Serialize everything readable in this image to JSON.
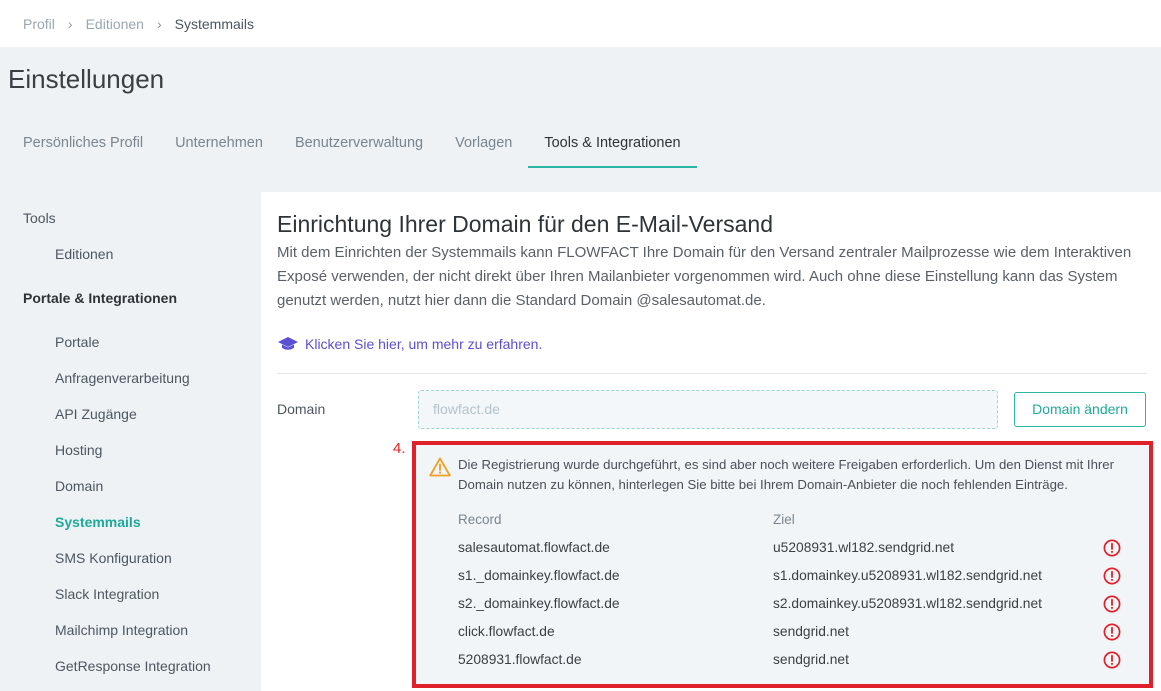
{
  "breadcrumb": {
    "items": [
      "Profil",
      "Editionen",
      "Systemmails"
    ]
  },
  "page_title": "Einstellungen",
  "tabs": [
    {
      "label": "Persönliches Profil",
      "active": false
    },
    {
      "label": "Unternehmen",
      "active": false
    },
    {
      "label": "Benutzerverwaltung",
      "active": false
    },
    {
      "label": "Vorlagen",
      "active": false
    },
    {
      "label": "Tools & Integrationen",
      "active": true
    }
  ],
  "sidebar": {
    "tools_heading": "Tools",
    "tools_items": [
      "Editionen"
    ],
    "portals_heading": "Portale & Integrationen",
    "portals_items": [
      "Portale",
      "Anfragenverarbeitung",
      "API Zugänge",
      "Hosting",
      "Domain",
      "Systemmails",
      "SMS Konfiguration",
      "Slack Integration",
      "Mailchimp Integration",
      "GetResponse Integration"
    ],
    "active_item": "Systemmails"
  },
  "main": {
    "title": "Einrichtung Ihrer Domain für den E-Mail-Versand",
    "description": "Mit dem Einrichten der Systemmails kann FLOWFACT Ihre Domain für den Versand zentraler Mailprozesse wie dem Interaktiven Exposé verwenden, der nicht direkt über Ihren Mailanbieter vorgenommen wird. Auch ohne diese Einstellung kann das System genutzt werden, nutzt hier dann die Standard Domain @salesautomat.de.",
    "learn_more": "Klicken Sie hier, um mehr zu erfahren.",
    "domain_label": "Domain",
    "domain_value": "flowfact.de",
    "domain_button": "Domain ändern",
    "step_label": "4.",
    "notice": {
      "message": "Die Registrierung wurde durchgeführt, es sind aber noch weitere Freigaben erforderlich. Um den Dienst mit Ihrer Domain nutzen zu können, hinterlegen Sie bitte bei Ihrem Domain-Anbieter die noch fehlenden Einträge.",
      "col_record": "Record",
      "col_target": "Ziel",
      "rows": [
        {
          "record": "salesautomat.flowfact.de",
          "target": "u5208931.wl182.sendgrid.net"
        },
        {
          "record": "s1._domainkey.flowfact.de",
          "target": "s1.domainkey.u5208931.wl182.sendgrid.net"
        },
        {
          "record": "s2._domainkey.flowfact.de",
          "target": "s2.domainkey.u5208931.wl182.sendgrid.net"
        },
        {
          "record": "click.flowfact.de",
          "target": "sendgrid.net"
        },
        {
          "record": "5208931.flowfact.de",
          "target": "sendgrid.net"
        }
      ]
    }
  },
  "colors": {
    "accent": "#1fa99b",
    "link": "#5b4fd4",
    "warning": "#f0a020",
    "error": "#e0202a"
  }
}
